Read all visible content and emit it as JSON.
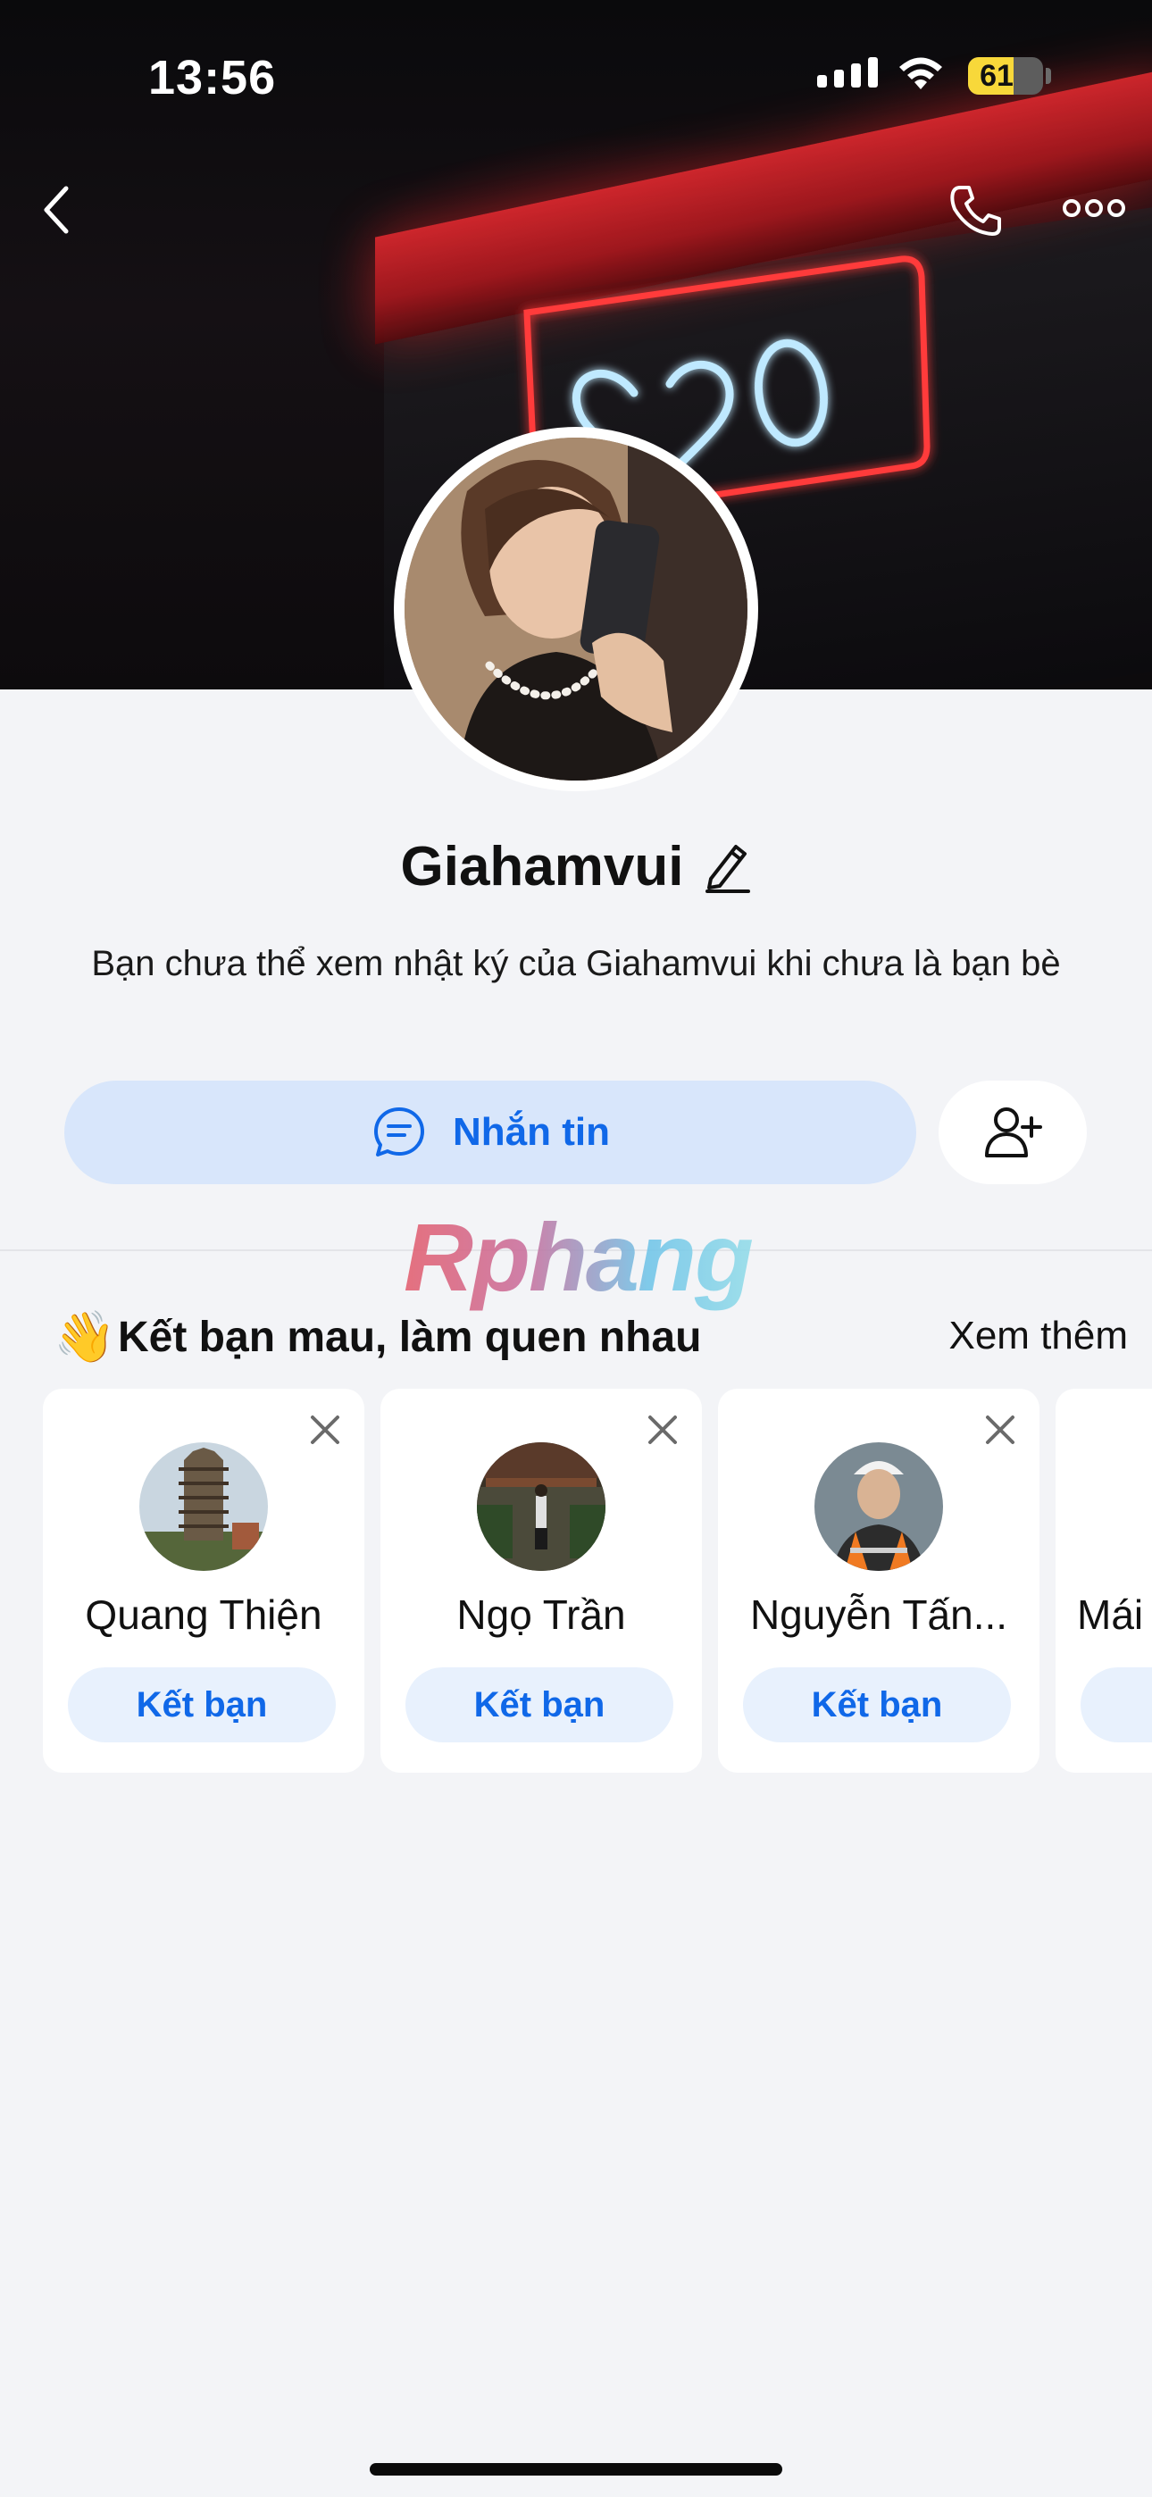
{
  "status_bar": {
    "time": "13:56",
    "battery": "61",
    "battery_level": 0.61
  },
  "header": {
    "back_icon": "chevron-left-icon",
    "call_icon": "phone-icon",
    "more_icon": "ellipsis-icon"
  },
  "profile": {
    "name": "Giahamvui",
    "description": "Bạn chưa thể xem nhật ký của Giahamvui khi chưa là bạn bè",
    "message_button": "Nhắn tin",
    "add_friend_icon": "add-person-icon"
  },
  "watermark": "Rphang",
  "suggestions": {
    "emoji": "👋",
    "title": "Kết bạn mau, làm quen nhau",
    "see_more": "Xem thêm",
    "items": [
      {
        "name": "Quang Thiện",
        "action": "Kết bạn"
      },
      {
        "name": "Ngọ Trần",
        "action": "Kết bạn"
      },
      {
        "name": "Nguyễn Tấn...",
        "action": "Kết bạn"
      },
      {
        "name": "Mái",
        "action": ""
      }
    ]
  },
  "colors": {
    "accent": "#1068e8",
    "accent_soft": "#d8e6fb",
    "background": "#f3f4f7",
    "neon_red": "#ff3b3b",
    "neon_blue": "#bfe9ff"
  }
}
